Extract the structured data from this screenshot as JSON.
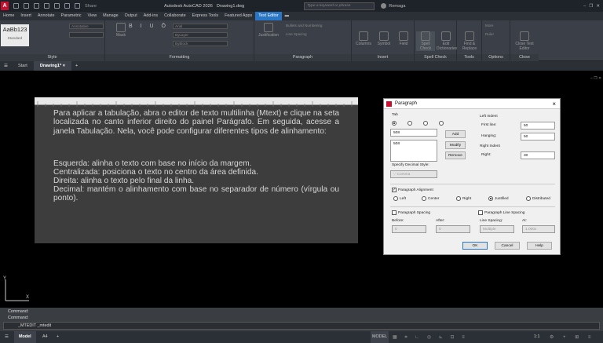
{
  "titlebar": {
    "app_title": "Autodesk AutoCAD 2026",
    "file_title": "Drawing1.dwg",
    "search_placeholder": "Type a keyword or phrase",
    "user": "Remaga",
    "share_label": "Share"
  },
  "ribbon_tabs": [
    "Home",
    "Insert",
    "Annotate",
    "Parametric",
    "View",
    "Manage",
    "Output",
    "Add-ins",
    "Collaborate",
    "Express Tools",
    "Featured Apps",
    "Text Editor"
  ],
  "ribbon": {
    "style_panel": {
      "label": "Style",
      "sample": "AaBb123",
      "sample_name": "Standard",
      "annotative": "Annotative",
      "mask": "Mask"
    },
    "formatting_panel": {
      "label": "Formatting",
      "font": "Arial",
      "color": "ByLayer",
      "bg": "ByBlock"
    },
    "paragraph_panel": {
      "label": "Paragraph",
      "justification": "Justification",
      "bullets": "Bullets and Numbering",
      "line_spacing": "Line Spacing"
    },
    "insert_panel": {
      "label": "Insert",
      "columns": "Columns",
      "symbol": "Symbol",
      "field": "Field"
    },
    "spell_panel": {
      "label": "Spell Check",
      "spell": "Spell Check",
      "edit_dict": "Edit Dictionaries"
    },
    "tools_panel": {
      "label": "Tools",
      "find": "Find & Replace"
    },
    "options_panel": {
      "label": "Options",
      "more": "More",
      "ruler": "Ruler"
    },
    "close_panel": {
      "label": "Close",
      "close": "Close Text Editor"
    }
  },
  "doc_tabs": {
    "start": "Start",
    "drawing": "Drawing1*"
  },
  "mtext": {
    "p1": "Para aplicar a tabulação, abra o editor de texto multilinha (Mtext) e clique na seta localizada no canto inferior direito do painel Parágrafo. Em seguida, acesse a janela Tabulação. Nela, você pode configurar diferentes tipos de alinhamento:",
    "l1": "Esquerda: alinha o texto com base no início da margem.",
    "l2": "Centralizada: posiciona o texto no centro da área definida.",
    "l3": "Direita: alinha o texto pelo final da linha.",
    "l4": "Decimal: mantém o alinhamento com base no separador de número (vírgula ou ponto)."
  },
  "dialog": {
    "title": "Paragraph",
    "tab_label": "Tab",
    "tab_value": "508",
    "tab_list_item": "508",
    "add": "Add",
    "modify": "Modify",
    "remove": "Remove",
    "decimal_label": "Specify Decimal Style:",
    "decimal_value": "',' Comma",
    "left_indent": "Left Indent",
    "first_line": "First line:",
    "first_line_value": "50",
    "hanging": "Hanging:",
    "hanging_value": "50",
    "right_indent": "Right Indent",
    "right": "Right:",
    "right_value": "30",
    "para_align": "Paragraph Alignment",
    "align_left": "Left",
    "align_center": "Center",
    "align_right": "Right",
    "align_justified": "Justified",
    "align_distributed": "Distributed",
    "para_spacing": "Paragraph Spacing",
    "before": "Before:",
    "before_value": "0",
    "after": "After:",
    "after_value": "0",
    "line_spacing": "Paragraph Line Spacing",
    "line_spacing_label": "Line Spacing:",
    "line_spacing_value": "Multiple",
    "at": "At:",
    "at_value": "1.000x",
    "ok": "OK",
    "cancel": "Cancel",
    "help": "Help"
  },
  "command": {
    "line1": "Command:",
    "line2": "Command:",
    "current": "_MTEDIT _mtedit"
  },
  "status": {
    "model": "Model",
    "layout": "A4",
    "mode": "MODEL",
    "scale": "1:1"
  },
  "colors": {
    "accent": "#2a76c6",
    "autocad_red": "#c8102e"
  }
}
